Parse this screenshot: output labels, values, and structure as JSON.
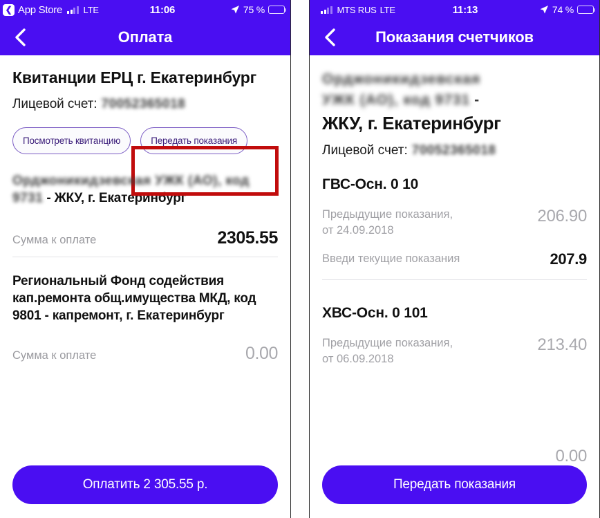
{
  "left": {
    "statusbar": {
      "back_label": "App Store",
      "back_icon": "chevron-left-icon",
      "signal_icon": "signal-bars-icon",
      "network": "LTE",
      "time": "11:06",
      "location_icon": "location-arrow-icon",
      "battery_percent": "75 %",
      "battery_icon": "battery-icon"
    },
    "nav": {
      "back_icon": "chevron-left-icon",
      "title": "Оплата"
    },
    "page_title": "Квитанции ЕРЦ г. Екатеринбург",
    "account_label": "Лицевой счет:",
    "account_value_masked": "70052365018",
    "buttons": {
      "view_receipt": "Посмотреть квитанцию",
      "submit_readings": "Передать показания"
    },
    "highlight_color": "#c10c0c",
    "sections": [
      {
        "org_masked": "Орджоникидзевская УЖК (АО), код",
        "org_masked_2": "9731",
        "org_visible": " - ЖКУ, г. Екатеринбург",
        "amount_label": "Сумма к оплате",
        "amount_value": "2305.55",
        "amount_muted": false
      },
      {
        "org_visible": "Региональный Фонд содействия кап.ремонта общ.имущества МКД, код 9801 - капремонт, г. Екатеринбург",
        "amount_label": "Сумма к оплате",
        "amount_value": "0.00",
        "amount_muted": true
      }
    ],
    "cta": "Оплатить 2 305.55 р."
  },
  "right": {
    "statusbar": {
      "signal_icon": "signal-bars-icon",
      "carrier": "MTS RUS",
      "network": "LTE",
      "time": "11:13",
      "location_icon": "location-arrow-icon",
      "battery_percent": "74 %",
      "battery_icon": "battery-icon"
    },
    "nav": {
      "back_icon": "chevron-left-icon",
      "title": "Показания счетчиков"
    },
    "org_masked_line1": "Орджоникидзевская",
    "org_masked_line2": "УЖК (АО), код 9731",
    "org_visible_dash": " -",
    "jku_title": "ЖКУ, г. Екатеринбург",
    "account_label": "Лицевой счет:",
    "account_value_masked": "70052365018",
    "meters": [
      {
        "name": "ГВС-Осн. 0 10",
        "previous_label": "Предыдущие показания,",
        "previous_date_label": "от 24.09.2018",
        "previous_value": "206.90",
        "current_label": "Введи текущие показания",
        "current_value": "207.9"
      },
      {
        "name": "ХВС-Осн. 0 101",
        "previous_label": "Предыдущие показания,",
        "previous_date_label": "от 06.09.2018",
        "previous_value": "213.40",
        "current_value_clipped": "0.00"
      }
    ],
    "cta": "Передать показания"
  }
}
